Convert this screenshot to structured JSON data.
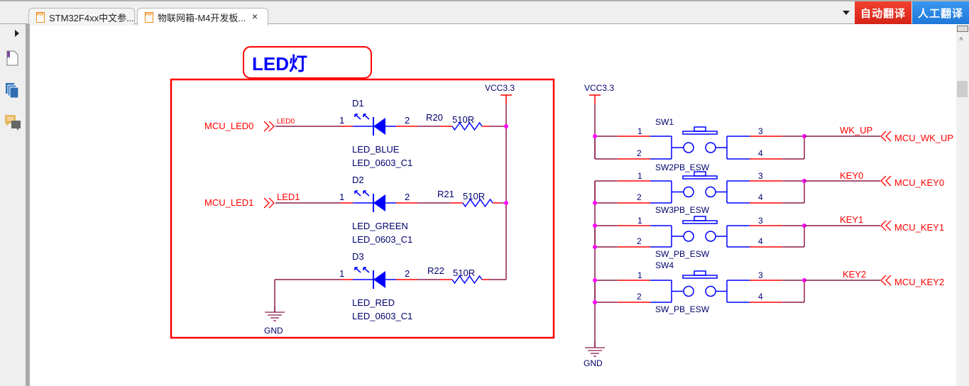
{
  "tabs": [
    {
      "label": "STM32F4xx中文参...",
      "icon": "pdf-icon",
      "active": false
    },
    {
      "label": "物联网箱-M4开发板...",
      "icon": "pdf-icon",
      "active": true,
      "close": "×"
    }
  ],
  "toolbar": {
    "auto_translate": "自动翻译",
    "manual_translate": "人工翻译",
    "auto_translate_color": "#e0301e",
    "manual_translate_color": "#2a88e6"
  },
  "left_panel": {
    "icons": [
      "expand-arrow-icon",
      "bookmark-page-icon",
      "pages-icon",
      "comments-icon"
    ]
  },
  "schematic": {
    "colors": {
      "wire": "#8c1c4c",
      "pin": "#ff0000",
      "part": "#0000ff",
      "junction": "#ff00ff",
      "label": "#00006e",
      "net": "#ff0000",
      "box": "#ff0000"
    },
    "led_section": {
      "title": "LED灯",
      "vcc": "VCC3.3",
      "gnd": "GND",
      "rows": [
        {
          "net_in": "MCU_LED0",
          "net": "LED0",
          "pin1": "1",
          "pin2": "2",
          "designator": "D1",
          "value": "LED_BLUE",
          "footprint": "LED_0603_C1",
          "res": "R20",
          "res_value": "510R"
        },
        {
          "net_in": "MCU_LED1",
          "net": "LED1",
          "pin1": "1",
          "pin2": "2",
          "designator": "D2",
          "value": "LED_GREEN",
          "footprint": "LED_0603_C1",
          "res": "R21",
          "res_value": "510R"
        },
        {
          "net_in": "",
          "net": "",
          "pin1": "1",
          "pin2": "2",
          "designator": "D3",
          "value": "LED_RED",
          "footprint": "LED_0603_C1",
          "res": "R22",
          "res_value": "510R"
        }
      ]
    },
    "key_section": {
      "vcc": "VCC3.3",
      "gnd": "GND",
      "rows": [
        {
          "designator": "SW1",
          "footprint": "SW2PB_ESW",
          "net": "WK_UP",
          "net_out": "MCU_WK_UP",
          "pins": [
            "1",
            "2",
            "3",
            "4"
          ]
        },
        {
          "designator": "",
          "footprint": "SW3PB_ESW",
          "net": "KEY0",
          "net_out": "MCU_KEY0",
          "pins": [
            "1",
            "2",
            "3",
            "4"
          ]
        },
        {
          "designator": "",
          "footprint": "SW_PB_ESW",
          "net": "KEY1",
          "net_out": "MCU_KEY1",
          "pins": [
            "1",
            "2",
            "3",
            "4"
          ]
        },
        {
          "designator": "SW4",
          "footprint": "SW_PB_ESW",
          "net": "KEY2",
          "net_out": "MCU_KEY2",
          "pins": [
            "1",
            "2",
            "3",
            "4"
          ]
        }
      ]
    }
  }
}
